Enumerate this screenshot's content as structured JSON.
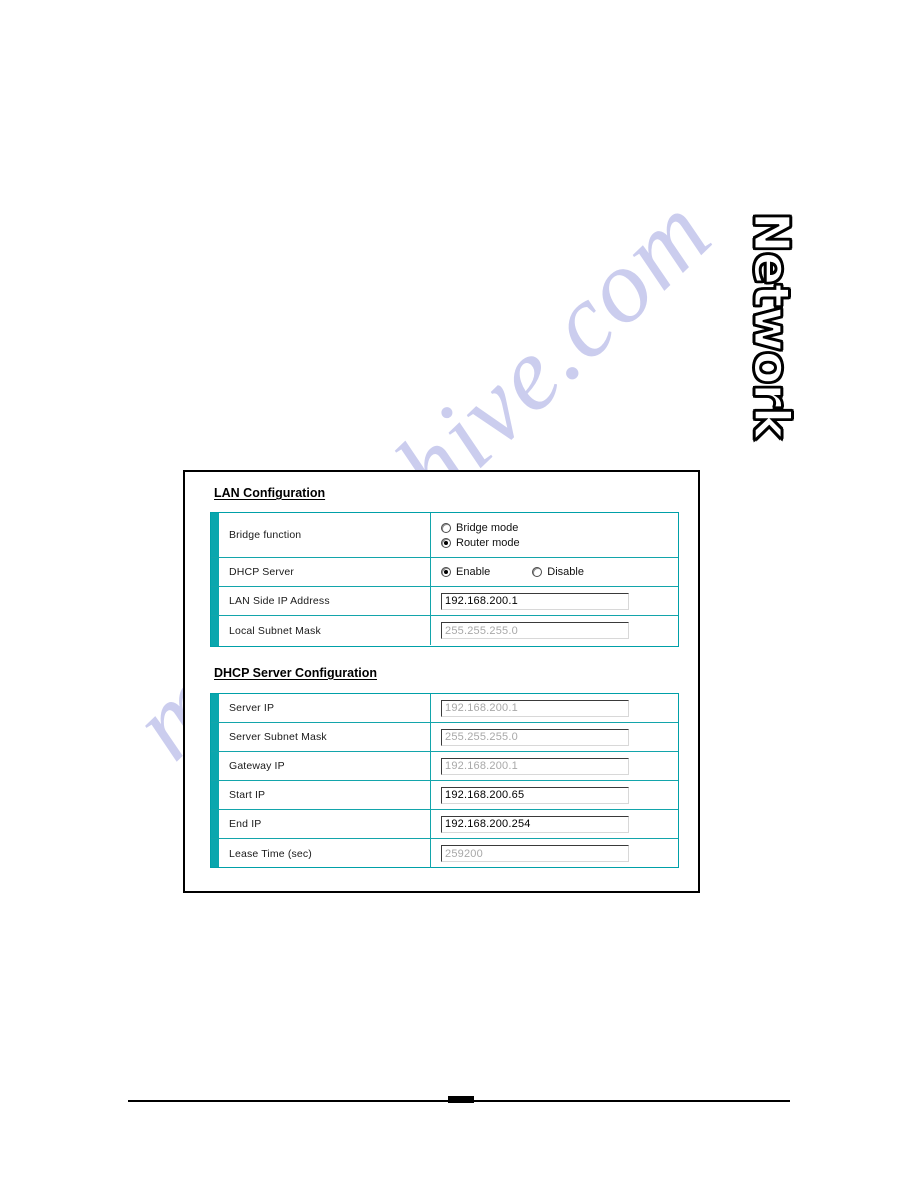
{
  "page": {
    "side_tab_label": "Network",
    "watermark_text": "manualshive.com"
  },
  "screen": {
    "lan_section": {
      "heading": "LAN Configuration",
      "rows": [
        {
          "label": "Bridge function",
          "type": "radio-stack",
          "options": [
            {
              "label": "Bridge mode",
              "checked": false
            },
            {
              "label": "Router mode",
              "checked": true
            }
          ]
        },
        {
          "label": "DHCP Server",
          "type": "radio-inline",
          "options": [
            {
              "label": "Enable",
              "checked": true
            },
            {
              "label": "Disable",
              "checked": false
            }
          ]
        },
        {
          "label": "LAN Side IP Address",
          "type": "input",
          "value": "192.168.200.1",
          "readonly": false
        },
        {
          "label": "Local Subnet Mask",
          "type": "input",
          "value": "255.255.255.0",
          "readonly": true
        }
      ]
    },
    "dhcp_section": {
      "heading": "DHCP Server Configuration",
      "rows": [
        {
          "label": "Server IP",
          "type": "input",
          "value": "192.168.200.1",
          "readonly": true
        },
        {
          "label": "Server Subnet Mask",
          "type": "input",
          "value": "255.255.255.0",
          "readonly": true
        },
        {
          "label": "Gateway IP",
          "type": "input",
          "value": "192.168.200.1",
          "readonly": true
        },
        {
          "label": "Start IP",
          "type": "input",
          "value": "192.168.200.65",
          "readonly": false
        },
        {
          "label": "End IP",
          "type": "input",
          "value": "192.168.200.254",
          "readonly": false
        },
        {
          "label": "Lease Time (sec)",
          "type": "input",
          "value": "259200",
          "readonly": true
        }
      ]
    }
  },
  "colors": {
    "table_border_teal": "#0aa7ae",
    "frame_black": "#000000",
    "watermark_lavender": "#c9cbee",
    "readonly_text_gray": "#a8a8a8"
  }
}
